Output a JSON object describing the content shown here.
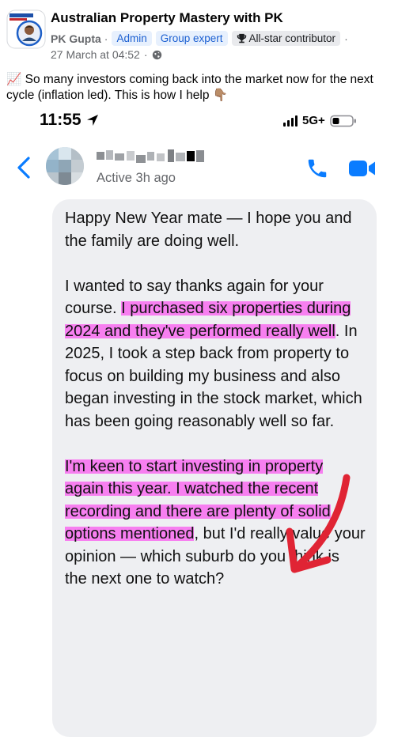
{
  "post": {
    "group_name": "Australian Property Mastery with PK",
    "author": "PK Gupta",
    "separator": "·",
    "badges": [
      "Admin",
      "Group expert",
      "All-star contributor"
    ],
    "trailing_separator": "·",
    "date": "27 March at 04:52",
    "date_separator": "·",
    "text": "📈 So many investors coming back into the market now for the next cycle (inflation led). This is how I help 👇🏽"
  },
  "phone": {
    "status_time": "11:55",
    "network": "5G+",
    "contact_status": "Active 3h ago"
  },
  "message": {
    "p1": "Happy New Year mate — I hope you and the family are doing well.",
    "p2_a": "I wanted to say thanks again for your course. ",
    "p2_b": "I purchased six properties during 2024 and they've performed really well",
    "p2_c": ". In 2025, I took a step back from property to focus on building my business and also began investing in the stock market, which has been going reasonably well so far.",
    "p3_a": "I'm keen to start investing in property again this year. I watched the recent recording and there are plenty of solid options mentioned",
    "p3_b": ", but I'd really value your opinion — which suburb do you think is the next one to watch?"
  },
  "colors": {
    "highlight": "#f77ff0",
    "arrow": "#e02434",
    "messenger_blue": "#0a7cff",
    "bubble": "#eeeff2",
    "badge_blue_text": "#1b5fd1"
  },
  "icons": [
    "avatar",
    "trophy-icon",
    "globe-icon",
    "location-arrow-icon",
    "signal-icon",
    "battery-icon",
    "back-chevron-icon",
    "phone-icon",
    "video-camera-icon",
    "red-arrow-icon"
  ]
}
